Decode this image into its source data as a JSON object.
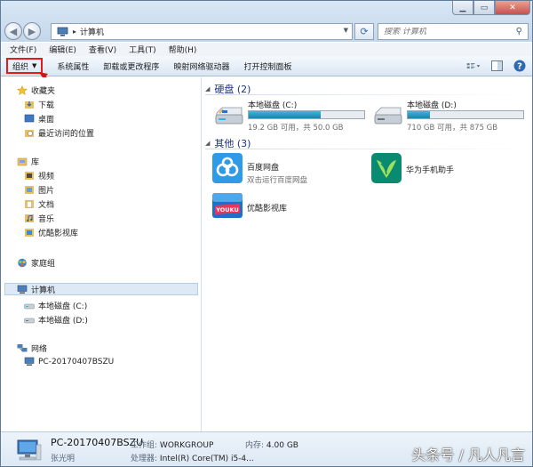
{
  "address": {
    "crumb": "计算机",
    "search_placeholder": "搜索 计算机"
  },
  "menubar": [
    "文件(F)",
    "编辑(E)",
    "查看(V)",
    "工具(T)",
    "帮助(H)"
  ],
  "commandbar": {
    "organize": "组织",
    "items": [
      "系统属性",
      "卸载或更改程序",
      "映射网络驱动器",
      "打开控制面板"
    ]
  },
  "navpane": {
    "favorites": "收藏夹",
    "favorites_items": [
      "下载",
      "桌面",
      "最近访问的位置"
    ],
    "libraries": "库",
    "library_items": [
      "视频",
      "图片",
      "文档",
      "音乐",
      "优酷影视库"
    ],
    "homegroup": "家庭组",
    "computer": "计算机",
    "computer_items": [
      "本地磁盘 (C:)",
      "本地磁盘 (D:)"
    ],
    "network": "网络",
    "network_items": [
      "PC-20170407BSZU"
    ]
  },
  "content": {
    "drives_header": "硬盘 (2)",
    "drives": [
      {
        "name": "本地磁盘 (C:)",
        "free": "19.2 GB 可用，共 50.0 GB",
        "used_fraction": 0.62
      },
      {
        "name": "本地磁盘 (D:)",
        "free": "710 GB 可用，共 875 GB",
        "used_fraction": 0.19
      }
    ],
    "other_header": "其他 (3)",
    "apps": [
      {
        "name": "百度网盘",
        "desc": "双击运行百度网盘"
      },
      {
        "name": "华为手机助手",
        "desc": ""
      },
      {
        "name": "优酷影视库",
        "desc": ""
      }
    ]
  },
  "details": {
    "pc_name": "PC-20170407BSZU",
    "workgroup_label": "工作组:",
    "workgroup_value": "WORKGROUP",
    "memory_label": "内存:",
    "memory_value": "4.00 GB",
    "user": "张光明",
    "cpu_label": "处理器:",
    "cpu_value": "Intel(R) Core(TM) i5-4..."
  },
  "watermark": "头条号 / 凡人凡言",
  "colors": {
    "accent_red": "#e21c1c",
    "group_header": "#1e3287",
    "drive_fill": "#1c83b0"
  },
  "icons": {
    "back": "back-arrow-icon",
    "forward": "forward-arrow-icon",
    "refresh": "refresh-icon",
    "search": "search-icon",
    "help": "help-icon"
  }
}
